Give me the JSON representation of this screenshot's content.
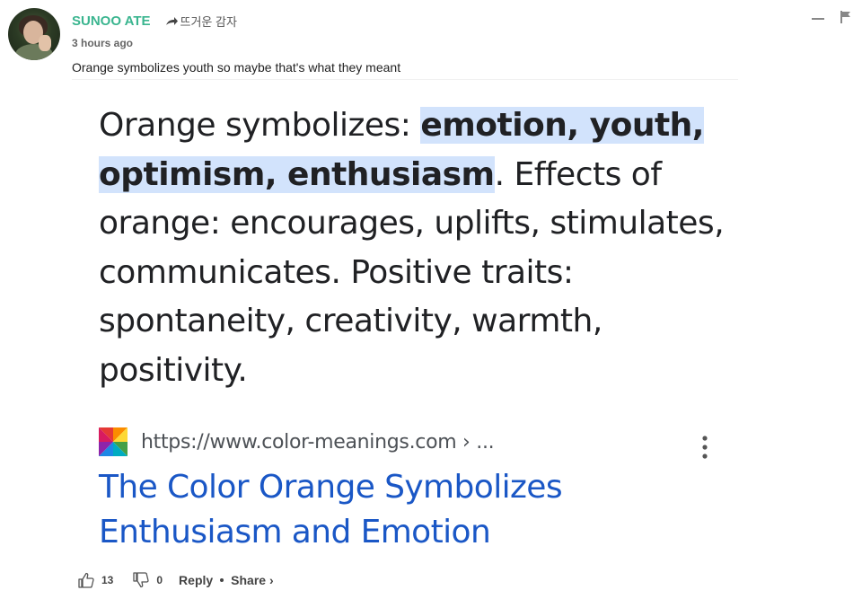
{
  "comment": {
    "author": "SUNOO ATE",
    "reply_to": "뜨거운 감자",
    "timestamp": "3 hours ago",
    "text": "Orange symbolizes youth so maybe that's what they meant"
  },
  "snippet": {
    "lead": "Orange symbolizes: ",
    "highlight": "emotion, youth, optimism, enthusiasm",
    "rest": ". Effects of orange: encourages, uplifts, stimulates, communicates. Positive traits: spontaneity, creativity, warmth, positivity."
  },
  "source": {
    "url": "https://www.color-meanings.com › ...",
    "title": "The Color Orange Symbolizes Enthusiasm and Emotion"
  },
  "actions": {
    "like_count": "13",
    "dislike_count": "0",
    "reply_label": "Reply",
    "share_label": "Share ›"
  },
  "colors": {
    "author": "#3ab58f",
    "highlight": "#d2e3fc",
    "link": "#1a57c6"
  },
  "icons": [
    "arrow-reply-icon",
    "minimize-icon",
    "flag-icon",
    "favicon-icon",
    "more-vert-icon",
    "thumbs-up-icon",
    "thumbs-down-icon"
  ]
}
